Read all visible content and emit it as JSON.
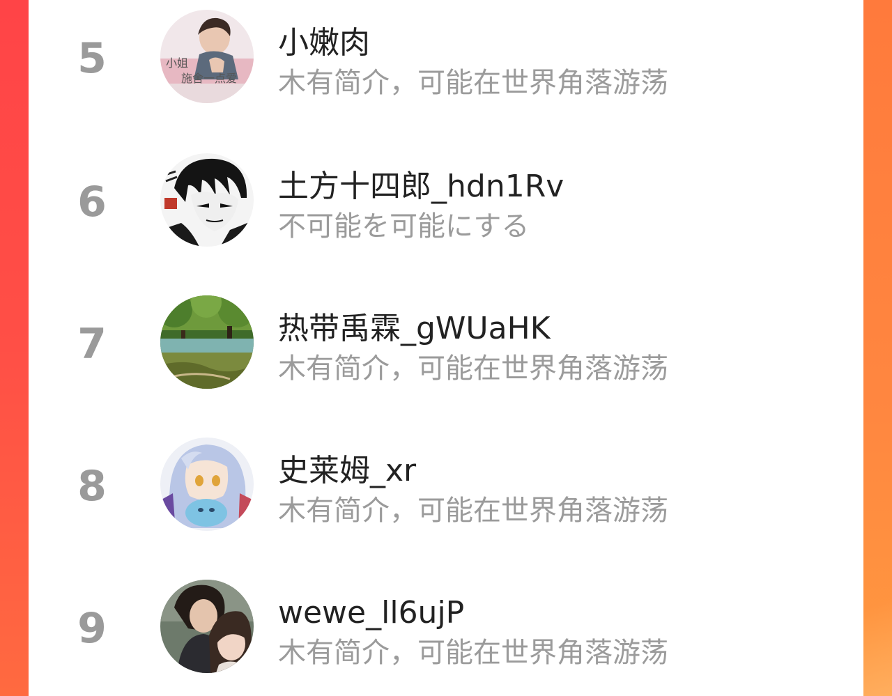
{
  "ranking": {
    "items": [
      {
        "rank": "5",
        "name": "小嫩肉",
        "bio": "木有简介，可能在世界角落游荡",
        "avatar_icon": "avatar-photo-person-pink",
        "avatar_caption_1": "小姐",
        "avatar_caption_2": "施舍一点爱"
      },
      {
        "rank": "6",
        "name": "土方十四郎_hdn1Rv",
        "bio": "不可能を可能にする",
        "avatar_icon": "avatar-anime-black-white"
      },
      {
        "rank": "7",
        "name": "热带禹霖_gWUaHK",
        "bio": "木有简介，可能在世界角落游荡",
        "avatar_icon": "avatar-forest-landscape"
      },
      {
        "rank": "8",
        "name": "史莱姆_xr",
        "bio": "木有简介，可能在世界角落游荡",
        "avatar_icon": "avatar-anime-blue-hair"
      },
      {
        "rank": "9",
        "name": "wewe_ll6ujP",
        "bio": "木有简介，可能在世界角落游荡",
        "avatar_icon": "avatar-couple-selfie"
      }
    ]
  },
  "colors": {
    "background_gradient_top": "#ff4a4a",
    "background_gradient_bottom": "#ff9a40",
    "card": "#ffffff",
    "rank_text": "#9a9a9a",
    "name_text": "#222222",
    "bio_text": "#9b9b9b"
  }
}
